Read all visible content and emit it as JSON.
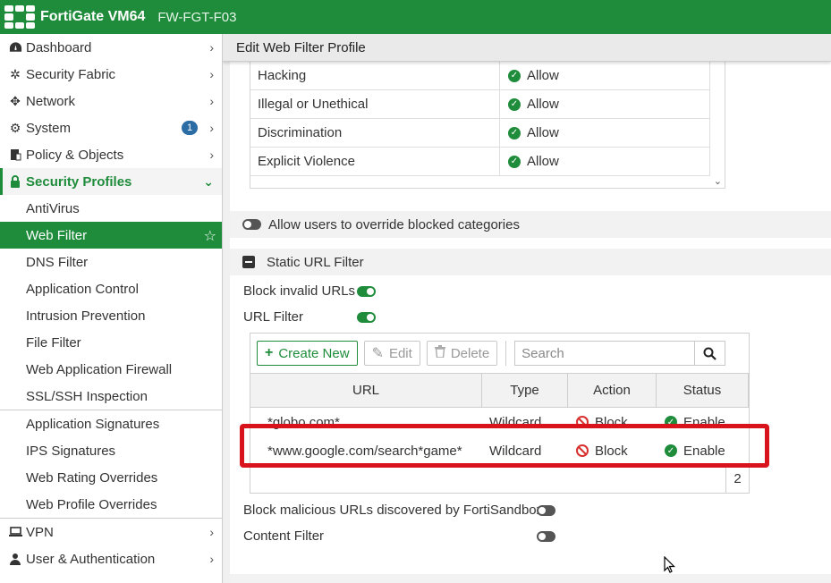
{
  "app": {
    "brand": "FortiGate VM64",
    "hostname": "FW-FGT-F03"
  },
  "sidebar": {
    "items": [
      {
        "label": "Dashboard"
      },
      {
        "label": "Security Fabric"
      },
      {
        "label": "Network"
      },
      {
        "label": "System",
        "badge": "1"
      },
      {
        "label": "Policy & Objects"
      },
      {
        "label": "Security Profiles"
      },
      {
        "label": "AntiVirus"
      },
      {
        "label": "Web Filter"
      },
      {
        "label": "DNS Filter"
      },
      {
        "label": "Application Control"
      },
      {
        "label": "Intrusion Prevention"
      },
      {
        "label": "File Filter"
      },
      {
        "label": "Web Application Firewall"
      },
      {
        "label": "SSL/SSH Inspection"
      },
      {
        "label": "Application Signatures"
      },
      {
        "label": "IPS Signatures"
      },
      {
        "label": "Web Rating Overrides"
      },
      {
        "label": "Web Profile Overrides"
      },
      {
        "label": "VPN"
      },
      {
        "label": "User & Authentication"
      }
    ]
  },
  "main": {
    "title": "Edit Web Filter Profile",
    "categories": [
      {
        "name": "Hacking",
        "action": "Allow"
      },
      {
        "name": "Illegal or Unethical",
        "action": "Allow"
      },
      {
        "name": "Discrimination",
        "action": "Allow"
      },
      {
        "name": "Explicit Violence",
        "action": "Allow"
      }
    ],
    "override_label": "Allow users to override blocked categories",
    "static_url_section": "Static URL Filter",
    "block_invalid_label": "Block invalid URLs",
    "url_filter_label": "URL Filter",
    "toolbar": {
      "create_new": "Create New",
      "edit": "Edit",
      "delete": "Delete",
      "search_placeholder": "Search"
    },
    "table": {
      "columns": [
        "URL",
        "Type",
        "Action",
        "Status"
      ],
      "rows": [
        {
          "url": "*globo.com*",
          "type": "Wildcard",
          "action": "Block",
          "status": "Enable"
        },
        {
          "url": "*www.google.com/search*game*",
          "type": "Wildcard",
          "action": "Block",
          "status": "Enable"
        }
      ],
      "count": "2"
    },
    "sandbox_label": "Block malicious URLs discovered by FortiSandbox",
    "content_filter_label": "Content Filter",
    "accent_color": "#1f8c3b",
    "highlight_color": "#d8131b"
  }
}
